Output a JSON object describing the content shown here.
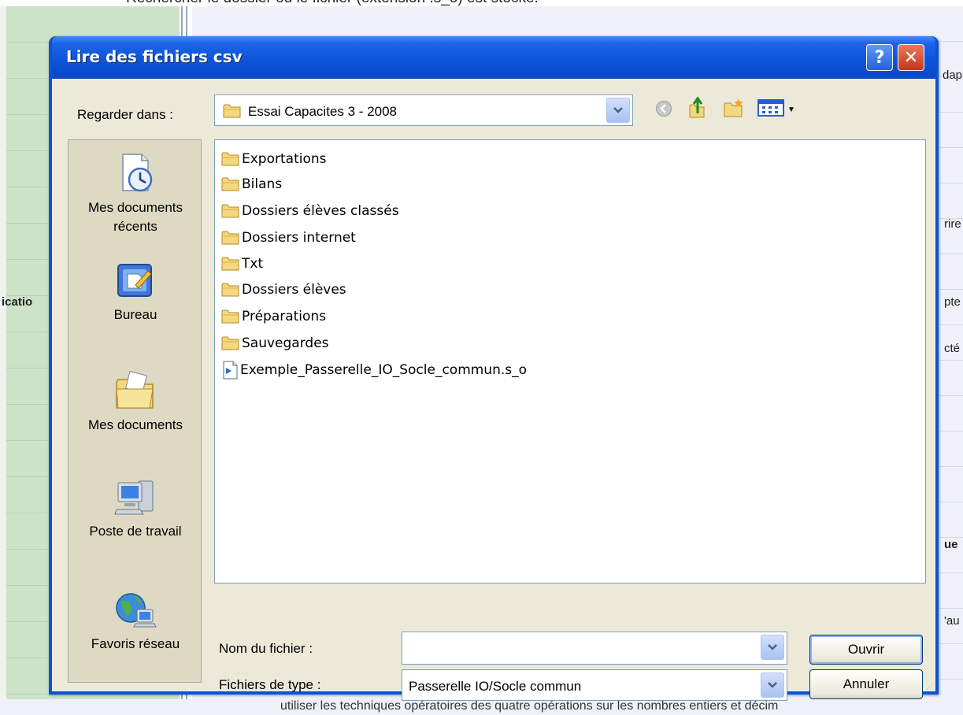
{
  "background": {
    "instruction_text": "Rechercher le dossier où le fichier (extension .s_o) est stocké.",
    "fragments": [
      "icatio",
      "dap",
      "rire",
      "pte",
      "cté",
      "ue",
      "'au"
    ],
    "bottom_text": "utiliser les techniques opératoires des quatre opérations sur les nombres entiers et décim"
  },
  "dialog": {
    "title": "Lire des fichiers csv",
    "help_label": "?",
    "close_label": "✕",
    "look_in_label": "Regarder dans :",
    "look_in_value": "Essai Capacites 3 - 2008",
    "places": [
      {
        "label_line1": "Mes documents",
        "label_line2": "récents"
      },
      {
        "label_line1": "Bureau"
      },
      {
        "label_line1": "Mes documents"
      },
      {
        "label_line1": "Poste de travail"
      },
      {
        "label_line1": "Favoris réseau"
      }
    ],
    "files": [
      {
        "name": "Exportations",
        "type": "folder"
      },
      {
        "name": "Bilans",
        "type": "folder"
      },
      {
        "name": "Dossiers élèves classés",
        "type": "folder"
      },
      {
        "name": "Dossiers internet",
        "type": "folder"
      },
      {
        "name": "Txt",
        "type": "folder"
      },
      {
        "name": "Dossiers élèves",
        "type": "folder"
      },
      {
        "name": "Préparations",
        "type": "folder"
      },
      {
        "name": "Sauvegardes",
        "type": "folder"
      },
      {
        "name": "Exemple_Passerelle_IO_Socle_commun.s_o",
        "type": "file"
      }
    ],
    "filename_label": "Nom du fichier :",
    "filename_value": "",
    "filetype_label": "Fichiers de type :",
    "filetype_value": "Passerelle IO/Socle commun",
    "open_button": "Ouvrir",
    "cancel_button": "Annuler"
  },
  "colors": {
    "titlebar": "#0a53d8",
    "dialog_body": "#ece9d8",
    "places_bar": "#ddd9c3",
    "folder": "#f3d27a"
  }
}
